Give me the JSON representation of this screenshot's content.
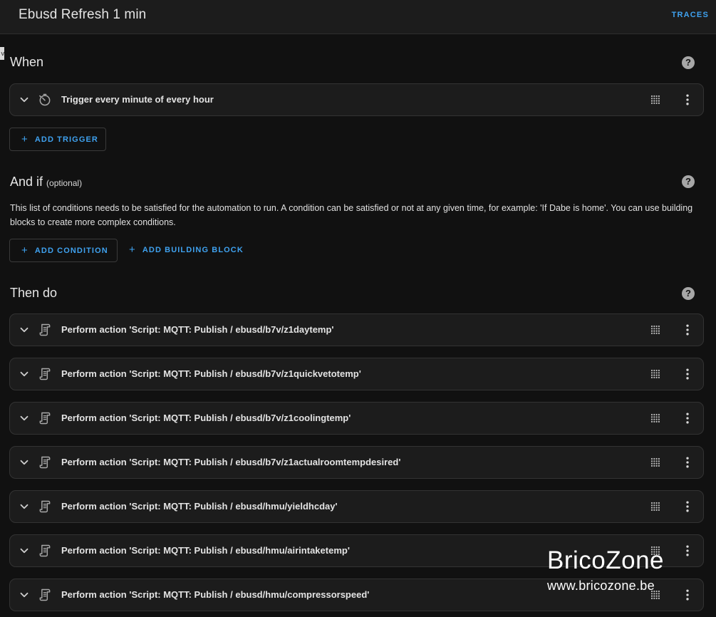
{
  "header": {
    "title": "Ebusd Refresh 1 min",
    "traces_label": "TRACES"
  },
  "edge_tab": "v",
  "when": {
    "title": "When",
    "help_glyph": "?",
    "triggers": [
      {
        "label": "Trigger every minute of every hour",
        "icon": "timer-clock-icon"
      }
    ],
    "add_trigger_label": "ADD TRIGGER"
  },
  "and_if": {
    "title": "And if",
    "optional": "(optional)",
    "help_glyph": "?",
    "description": "This list of conditions needs to be satisfied for the automation to run. A condition can be satisfied or not at any given time, for example: 'If Dabe is home'. You can use building blocks to create more complex conditions.",
    "add_condition_label": "ADD CONDITION",
    "add_building_block_label": "ADD BUILDING BLOCK"
  },
  "then_do": {
    "title": "Then do",
    "help_glyph": "?",
    "actions": [
      {
        "label": "Perform action 'Script: MQTT: Publish / ebusd/b7v/z1daytemp'",
        "icon": "script-icon"
      },
      {
        "label": "Perform action 'Script: MQTT: Publish / ebusd/b7v/z1quickvetotemp'",
        "icon": "script-icon"
      },
      {
        "label": "Perform action 'Script: MQTT: Publish / ebusd/b7v/z1coolingtemp'",
        "icon": "script-icon"
      },
      {
        "label": "Perform action 'Script: MQTT: Publish / ebusd/b7v/z1actualroomtempdesired'",
        "icon": "script-icon"
      },
      {
        "label": "Perform action 'Script: MQTT: Publish / ebusd/hmu/yieldhcday'",
        "icon": "script-icon"
      },
      {
        "label": "Perform action 'Script: MQTT: Publish / ebusd/hmu/airintaketemp'",
        "icon": "script-icon"
      },
      {
        "label": "Perform action 'Script: MQTT: Publish / ebusd/hmu/compressorspeed'",
        "icon": "script-icon"
      }
    ]
  },
  "watermark": {
    "brand": "BricoZone",
    "url": "www.bricozone.be"
  },
  "colors": {
    "accent": "#3fa2f0",
    "background": "#111111",
    "card": "#1c1c1c"
  }
}
